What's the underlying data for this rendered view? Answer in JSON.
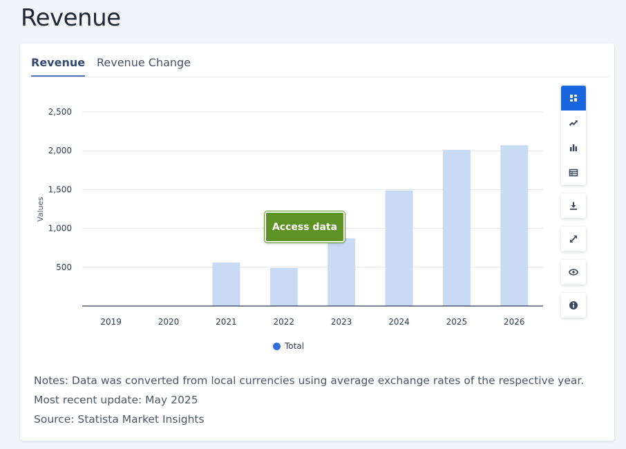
{
  "page": {
    "title": "Revenue"
  },
  "tabs": [
    {
      "label": "Revenue",
      "active": true
    },
    {
      "label": "Revenue Change",
      "active": false
    }
  ],
  "chart_data": {
    "type": "bar",
    "categories": [
      "2019",
      "2020",
      "2021",
      "2022",
      "2023",
      "2024",
      "2025",
      "2026"
    ],
    "series": [
      {
        "name": "Total",
        "values": [
          0,
          0,
          560,
          490,
          870,
          1490,
          2010,
          2070
        ]
      }
    ],
    "ylabel": "Values",
    "xlabel": "",
    "yticks": [
      "500",
      "1,000",
      "1,500",
      "2,000",
      "2,500"
    ],
    "ytick_values": [
      500,
      1000,
      1500,
      2000,
      2500
    ],
    "ylim": [
      0,
      2500
    ],
    "grid": true,
    "legend": "bottom-center",
    "bar_color": "#c9dbf4",
    "legend_color": "#2e6fd8"
  },
  "access_button": {
    "label": "Access data",
    "color": "#5e9224"
  },
  "notes": {
    "line1": "Notes: Data was converted from local currencies using average exchange rates of the respective year.",
    "line2": "Most recent update: May 2025",
    "line3": "Source: Statista Market Insights"
  },
  "toolbar": {
    "icons": [
      "dashboard-icon",
      "line-chart-icon",
      "bar-chart-icon",
      "table-icon",
      "download-icon",
      "expand-icon",
      "eye-icon",
      "info-icon"
    ],
    "accent": "#1a66e0"
  }
}
